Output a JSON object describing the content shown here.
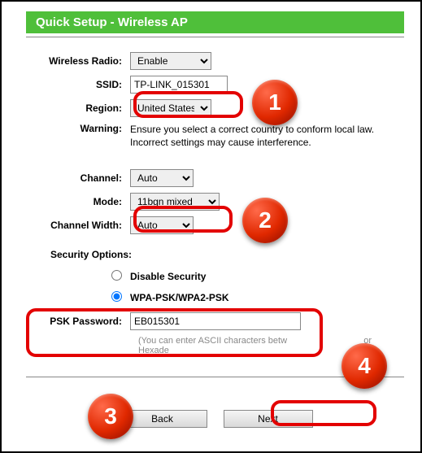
{
  "header": {
    "title": "Quick Setup - Wireless AP"
  },
  "form": {
    "wireless_radio": {
      "label": "Wireless Radio:",
      "value": "Enable"
    },
    "ssid": {
      "label": "SSID:",
      "value": "TP-LINK_015301"
    },
    "region": {
      "label": "Region:",
      "value": "United States"
    },
    "warning": {
      "label": "Warning:",
      "text": "Ensure you select a correct country to conform local law. Incorrect settings may cause interference."
    },
    "channel": {
      "label": "Channel:",
      "value": "Auto"
    },
    "mode": {
      "label": "Mode:",
      "value": "11bgn mixed"
    },
    "channel_width": {
      "label": "Channel Width:",
      "value": "Auto"
    }
  },
  "security": {
    "heading": "Security Options:",
    "disable_label": "Disable Security",
    "wpa_label": "WPA-PSK/WPA2-PSK",
    "psk_label": "PSK Password:",
    "psk_value": "EB015301",
    "hint_prefix": "(You can enter ASCII characters betw",
    "hint_suffix": "or Hexade"
  },
  "buttons": {
    "back": "Back",
    "next": "Next"
  },
  "annotations": {
    "b1": "1",
    "b2": "2",
    "b3": "3",
    "b4": "4"
  }
}
